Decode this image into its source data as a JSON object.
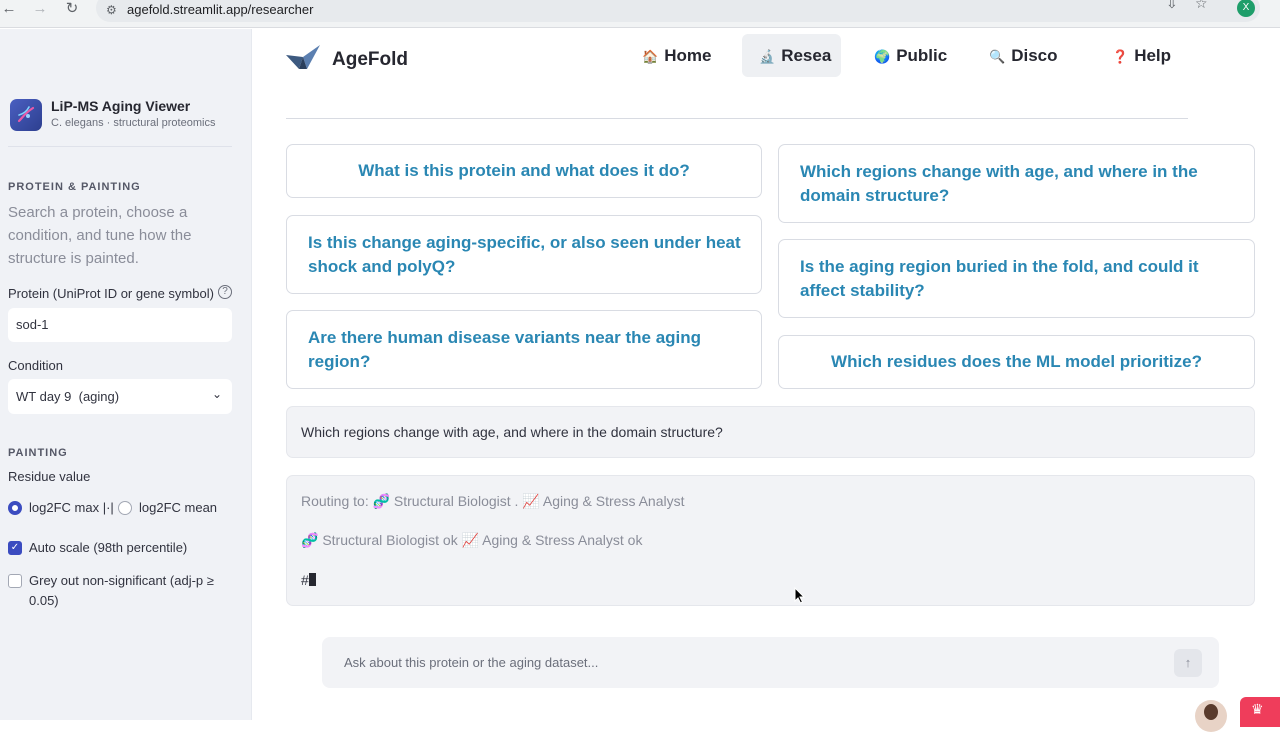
{
  "browser": {
    "url": "agefold.streamlit.app/researcher",
    "profile_initial": "X"
  },
  "sidebar": {
    "app_title": "LiP-MS Aging Viewer",
    "app_subtitle": "C. elegans · structural proteomics",
    "section_protein": "PROTEIN & PAINTING",
    "intro": "Search a protein, choose a condition, and tune how the structure is painted.",
    "protein_label": "Protein (UniProt ID or gene symbol)",
    "protein_value": "sod-1",
    "condition_label": "Condition",
    "condition_value": "WT day 9  (aging)",
    "section_painting": "PAINTING",
    "residue_label": "Residue value",
    "radio_max": "log2FC max |·|",
    "radio_mean": "log2FC mean",
    "radio_selected": "log2FC max",
    "auto_scale_label": "Auto scale (98th percentile)",
    "auto_scale_checked": true,
    "grey_out_label": "Grey out non-significant (adj-p ≥ 0.05)",
    "grey_out_checked": false
  },
  "header": {
    "brand": "AgeFold",
    "nav": [
      {
        "icon": "🏠",
        "label": "Home"
      },
      {
        "icon": "🔬",
        "label": "Resea"
      },
      {
        "icon": "🌍",
        "label": "Public"
      },
      {
        "icon": "🔍",
        "label": "Disco"
      },
      {
        "icon": "❓",
        "label": "Help"
      }
    ],
    "active_nav": "Resea"
  },
  "questions": [
    "What is this protein and what does it do?",
    "Which regions change with age, and where in the domain structure?",
    "Is this change aging-specific, or also seen under heat shock and polyQ?",
    "Is the aging region buried in the fold, and could it affect stability?",
    "Are there human disease variants near the aging region?",
    "Which residues does the ML model prioritize?"
  ],
  "chat": {
    "user_message": "Which regions change with age, and where in the domain structure?",
    "routing_line": "Routing to: 🧬 Structural Biologist . 📈 Aging & Stress Analyst",
    "status_line": "🧬 Structural Biologist ok 📈 Aging & Stress Analyst ok",
    "streaming_text": "#",
    "input_placeholder": "Ask about this protein or the aging dataset..."
  },
  "colors": {
    "accent": "#3b4cc0",
    "question_text": "#2a87b3",
    "badge": "#ef3d5b"
  }
}
